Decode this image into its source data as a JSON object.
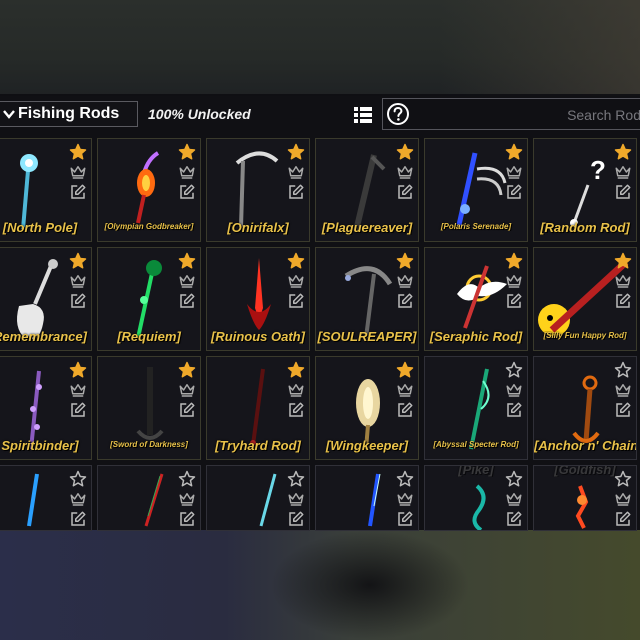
{
  "header": {
    "title": "Fishing Rods",
    "unlocked": "100% Unlocked",
    "search_placeholder": "Search Rod"
  },
  "colors": {
    "accent_gold": "#e8c14a",
    "star_gold": "#f0a92a",
    "panel_bg": "#0e0e12"
  },
  "rows": [
    [
      {
        "name": "[North Pole]",
        "favorite": true,
        "icon": "north-pole-rod"
      },
      {
        "name": "[Olympian Godbreaker]",
        "favorite": true,
        "icon": "olympian-godbreaker-rod",
        "small": true
      },
      {
        "name": "[Onirifalx]",
        "favorite": true,
        "icon": "onirifalx-rod"
      },
      {
        "name": "[Plaguereaver]",
        "favorite": true,
        "icon": "plaguereaver-rod"
      },
      {
        "name": "[Polaris Serenade]",
        "favorite": true,
        "icon": "polaris-serenade-rod",
        "small": true
      },
      {
        "name": "[Random Rod]",
        "favorite": true,
        "icon": "random-rod"
      }
    ],
    [
      {
        "name": "Remembrance]",
        "favorite": true,
        "icon": "remembrance-rod"
      },
      {
        "name": "[Requiem]",
        "favorite": true,
        "icon": "requiem-rod"
      },
      {
        "name": "[Ruinous Oath]",
        "favorite": true,
        "icon": "ruinous-oath-rod"
      },
      {
        "name": "[SOULREAPER]",
        "favorite": true,
        "icon": "soulreaper-rod"
      },
      {
        "name": "[Seraphic Rod]",
        "favorite": true,
        "icon": "seraphic-rod"
      },
      {
        "name": "[Silly Fun Happy Rod]",
        "favorite": true,
        "icon": "silly-fun-happy-rod",
        "small": true
      }
    ],
    [
      {
        "name": "Spiritbinder]",
        "favorite": true,
        "icon": "spiritbinder-rod"
      },
      {
        "name": "[Sword of Darkness]",
        "favorite": true,
        "icon": "sword-of-darkness-rod",
        "small": true
      },
      {
        "name": "[Tryhard Rod]",
        "favorite": true,
        "icon": "tryhard-rod"
      },
      {
        "name": "[Wingkeeper]",
        "favorite": true,
        "icon": "wingkeeper-rod"
      },
      {
        "name": "[Abyssal Specter Rod]",
        "favorite": false,
        "icon": "abyssal-specter-rod",
        "small": true
      },
      {
        "name": "[Anchor n' Chain]",
        "favorite": false,
        "icon": "anchor-n-chain-rod"
      }
    ],
    [
      {
        "name": "",
        "favorite": false,
        "icon": "blue-spear-rod"
      },
      {
        "name": "",
        "favorite": false,
        "icon": "red-spear-rod"
      },
      {
        "name": "",
        "favorite": false,
        "icon": "teal-spear-rod"
      },
      {
        "name": "",
        "favorite": false,
        "icon": "blue-blade-rod"
      },
      {
        "name": "[Pike]",
        "favorite": false,
        "icon": "pike-rod",
        "faded": true
      },
      {
        "name": "[Goldfish]",
        "favorite": false,
        "icon": "goldfish-rod",
        "faded": true
      }
    ]
  ]
}
